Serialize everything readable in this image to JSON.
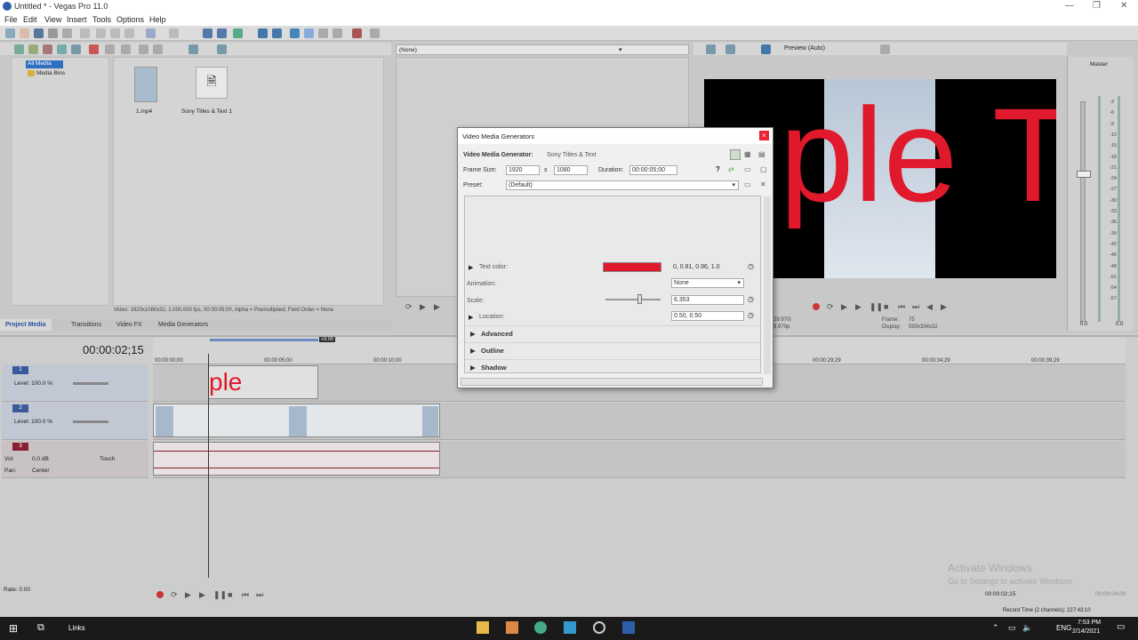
{
  "app": {
    "title": "Untitled * - Vegas Pro 11.0",
    "menu": [
      "File",
      "Edit",
      "View",
      "Insert",
      "Tools",
      "Options",
      "Help"
    ]
  },
  "explorer": {
    "tree": [
      "All Media",
      "Media Bins"
    ],
    "files": [
      {
        "name": "1.mp4"
      },
      {
        "name": "Sony Titles & Text 1"
      }
    ],
    "status": "Video: 1920x1080x32, 1.000.000 fps, 00:00:05;00, Alpha = Premultiplied, Field Order = None",
    "tabs": [
      "Project Media",
      "Transitions",
      "Video FX",
      "Media Generators"
    ]
  },
  "trimmer": {
    "preset_select": "(None)"
  },
  "preview": {
    "mode": "Preview (Auto)",
    "text": "ple T",
    "frame_label": "Frame:",
    "frame_value": "75",
    "display_label": "Display:",
    "display_value": "593x334x32",
    "fps_a": "29.970i",
    "fps_b": "9.970p"
  },
  "master": {
    "label": "Master",
    "scale": [
      "3",
      "6",
      "9",
      "12",
      "15",
      "18",
      "21",
      "24",
      "27",
      "30",
      "33",
      "36",
      "39",
      "42",
      "45",
      "48",
      "51",
      "54",
      "57"
    ],
    "val_left": "0.0",
    "val_right": "0.0"
  },
  "timeline": {
    "timecode": "00:00:02;15",
    "marker": "+5:00",
    "ruler": [
      "00:00:00;00",
      "00:00:05;00",
      "00:00:10;00",
      "00:00:29;29",
      "00:00:34;29",
      "00:00:39;29"
    ],
    "tracks": [
      {
        "num": "1",
        "level": "Level: 100.0 %"
      },
      {
        "num": "2",
        "level": "Level: 100.0 %"
      },
      {
        "num": "3",
        "vol_label": "Vol:",
        "vol": "0.0 dB",
        "mode": "Touch",
        "pan_label": "Pan:",
        "pan": "Center"
      }
    ],
    "clip_text": "ple",
    "rate": "Rate: 0.00",
    "end_time": "00:00:02;15",
    "end_time2": "00:00:04;00",
    "record_time": "Record Time (2 channels): 227:43:10"
  },
  "dialog": {
    "title": "Video Media Generators",
    "generator_label": "Video Media Generator:",
    "generator_value": "Sony Titles & Text",
    "frame_size_label": "Frame Size:",
    "width": "1920",
    "x": "x",
    "height": "1080",
    "duration_label": "Duration:",
    "duration": "00:00:05;00",
    "preset_label": "Preset:",
    "preset_value": "(Default)",
    "props": {
      "text_color_label": "Text color:",
      "text_color_value": "0, 0.81, 0.96, 1.0",
      "text_color_hex": "#e0192c",
      "animation_label": "Animation:",
      "animation_value": "None",
      "scale_label": "Scale:",
      "scale_value": "6.353",
      "scale_fraction": 0.62,
      "location_label": "Location:",
      "location_value": "0.50, 0.50"
    },
    "sections": [
      "Advanced",
      "Outline",
      "Shadow"
    ]
  },
  "watermark": {
    "line1": "Activate Windows",
    "line2": "Go to Settings to activate Windows."
  },
  "taskbar": {
    "links": "Links",
    "lang": "ENG",
    "time": "7:53 PM",
    "date": "2/14/2021"
  }
}
